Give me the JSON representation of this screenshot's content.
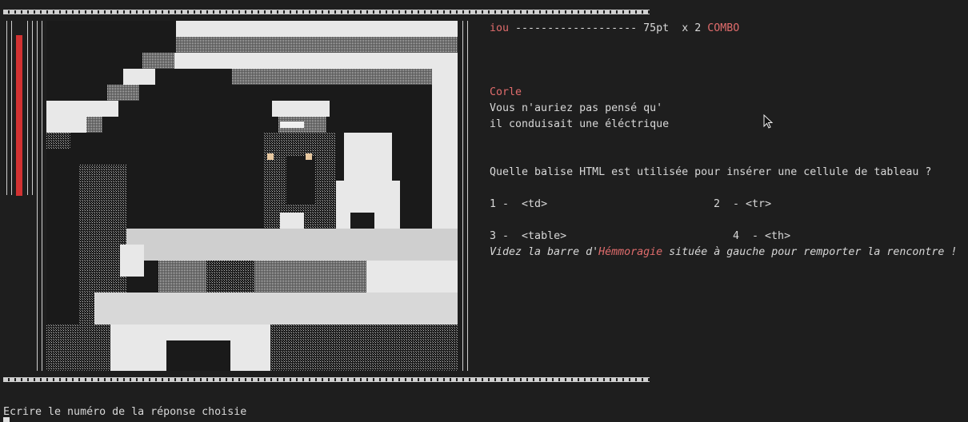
{
  "status": {
    "player": "iou",
    "dashes": " ------------------- ",
    "score": "75pt",
    "combo_mult": "x 2",
    "combo_label": "COMBO"
  },
  "dialogue": {
    "speaker": "Corle",
    "line1": "Vous n'auriez pas pensé qu'",
    "line2": "il conduisait une éléctrique"
  },
  "question": {
    "text": "Quelle balise HTML est utilisée pour insérer une cellule de tableau ?",
    "answers": [
      {
        "num": "1 -",
        "label": "<td>"
      },
      {
        "num": "2  -",
        "label": "<tr>"
      },
      {
        "num": "3 -",
        "label": "<table>"
      },
      {
        "num": "4  -",
        "label": "<th>"
      }
    ]
  },
  "hint": {
    "before": "Videz la barre d'",
    "highlight": "Hémmoragie",
    "after": " située à gauche pour remporter la rencontre !"
  },
  "prompt": "Ecrire le numéro de la réponse choisie",
  "colors": {
    "accent_red": "#e06c6c",
    "bar_red": "#d23232",
    "background": "#1e1e1e"
  }
}
